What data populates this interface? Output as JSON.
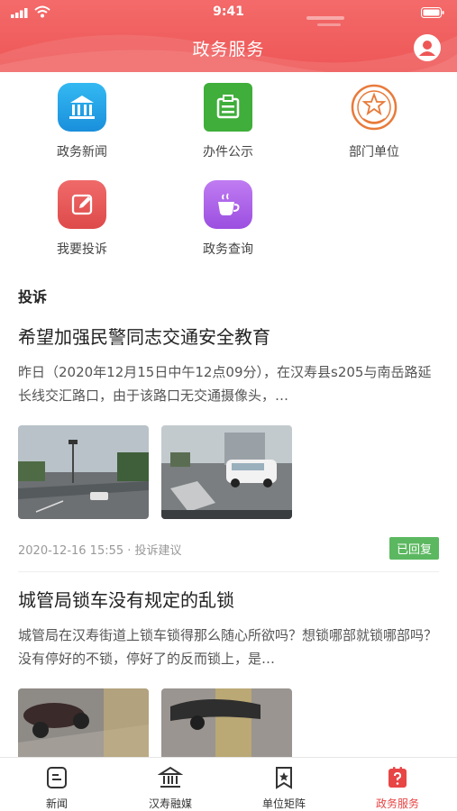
{
  "status_bar": {
    "time": "9:41"
  },
  "header": {
    "title": "政务服务",
    "accent": "#ee5656"
  },
  "quick_links": [
    {
      "label": "政务新闻",
      "icon": "bank-icon",
      "color": "#1aa3e8"
    },
    {
      "label": "办件公示",
      "icon": "notice-board-icon",
      "color": "#3fae3a"
    },
    {
      "label": "部门单位",
      "icon": "police-emblem-icon",
      "color": "#e87a3a"
    },
    {
      "label": "我要投诉",
      "icon": "edit-icon",
      "color": "#e85a5a"
    },
    {
      "label": "政务查询",
      "icon": "coffee-cup-icon",
      "color": "#a35be0"
    }
  ],
  "section": {
    "title": "投诉"
  },
  "complaints": [
    {
      "title": "希望加强民警同志交通安全教育",
      "desc": "昨日（2020年12月15日中午12点09分），在汉寿县s205与南岳路延长线交汇路口，由于该路口无交通摄像头，…",
      "meta": "2020-12-16 15:55 · 投诉建议",
      "status": "已回复"
    },
    {
      "title": "城管局锁车没有规定的乱锁",
      "desc": "城管局在汉寿街道上锁车锁得那么随心所欲吗？想锁哪部就锁哪部吗？没有停好的不锁，停好了的反而锁上，是…"
    }
  ],
  "tabbar": [
    {
      "label": "新闻",
      "icon": "news-icon"
    },
    {
      "label": "汉寿融媒",
      "icon": "media-building-icon"
    },
    {
      "label": "单位矩阵",
      "icon": "bookmark-star-icon"
    },
    {
      "label": "政务服务",
      "icon": "service-question-icon",
      "active": true
    }
  ]
}
